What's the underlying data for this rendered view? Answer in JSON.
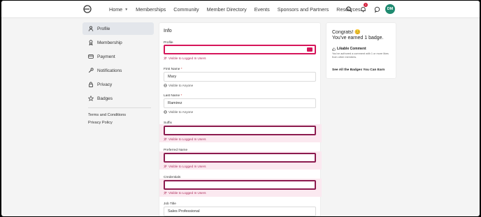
{
  "topnav": {
    "items": [
      {
        "label": "Home",
        "has_dropdown": true
      },
      {
        "label": "Memberships"
      },
      {
        "label": "Community"
      },
      {
        "label": "Member Directory"
      },
      {
        "label": "Events"
      },
      {
        "label": "Sponsors and Partners"
      },
      {
        "label": "Resources"
      }
    ],
    "notification_count": "1",
    "avatar_initials": "DM"
  },
  "sidebar": {
    "items": [
      {
        "label": "Profile",
        "icon": "person-icon",
        "active": true
      },
      {
        "label": "Membership",
        "icon": "ribbon-icon"
      },
      {
        "label": "Payment",
        "icon": "credit-card-icon"
      },
      {
        "label": "Notifications",
        "icon": "wrench-icon"
      },
      {
        "label": "Privacy",
        "icon": "lock-icon"
      },
      {
        "label": "Badges",
        "icon": "star-icon"
      }
    ],
    "links": [
      "Terms and Conditions",
      "Privacy Policy"
    ]
  },
  "form": {
    "title": "Info",
    "fields": [
      {
        "label": "Profile",
        "required": false,
        "value": "",
        "visibility": "Visible to Logged In Users"
      },
      {
        "label": "First Name",
        "required": true,
        "value": "Mary",
        "visibility": "Visible to Anyone"
      },
      {
        "label": "Last Name",
        "required": true,
        "value": "Ramirez",
        "visibility": "Visible to Anyone"
      },
      {
        "label": "Suffix",
        "required": false,
        "value": "",
        "visibility": "Visible to Logged In Users"
      },
      {
        "label": "Preferred Name",
        "required": false,
        "value": "",
        "visibility": "Visible to Logged In Users"
      },
      {
        "label": "Credentials",
        "required": false,
        "value": "",
        "visibility": "Visible to Logged In Users"
      },
      {
        "label": "Job Title",
        "required": false,
        "value": "Sales Professional",
        "visibility": ""
      }
    ]
  },
  "badges_card": {
    "congrats": "Congrats! 😊",
    "earned": "You've earned 1 badge.",
    "badge_name": "Likable Comment",
    "badge_desc": "You've authored a comment with 1 or more likes from other members.",
    "link": "See All the Badges You Can Earn"
  },
  "colors": {
    "highlight_border": "#8c1b4f",
    "highlight_band": "#fbe9f0",
    "accent_avatar": "#1f8a70",
    "active_sidebar": "#e3e6eb"
  }
}
